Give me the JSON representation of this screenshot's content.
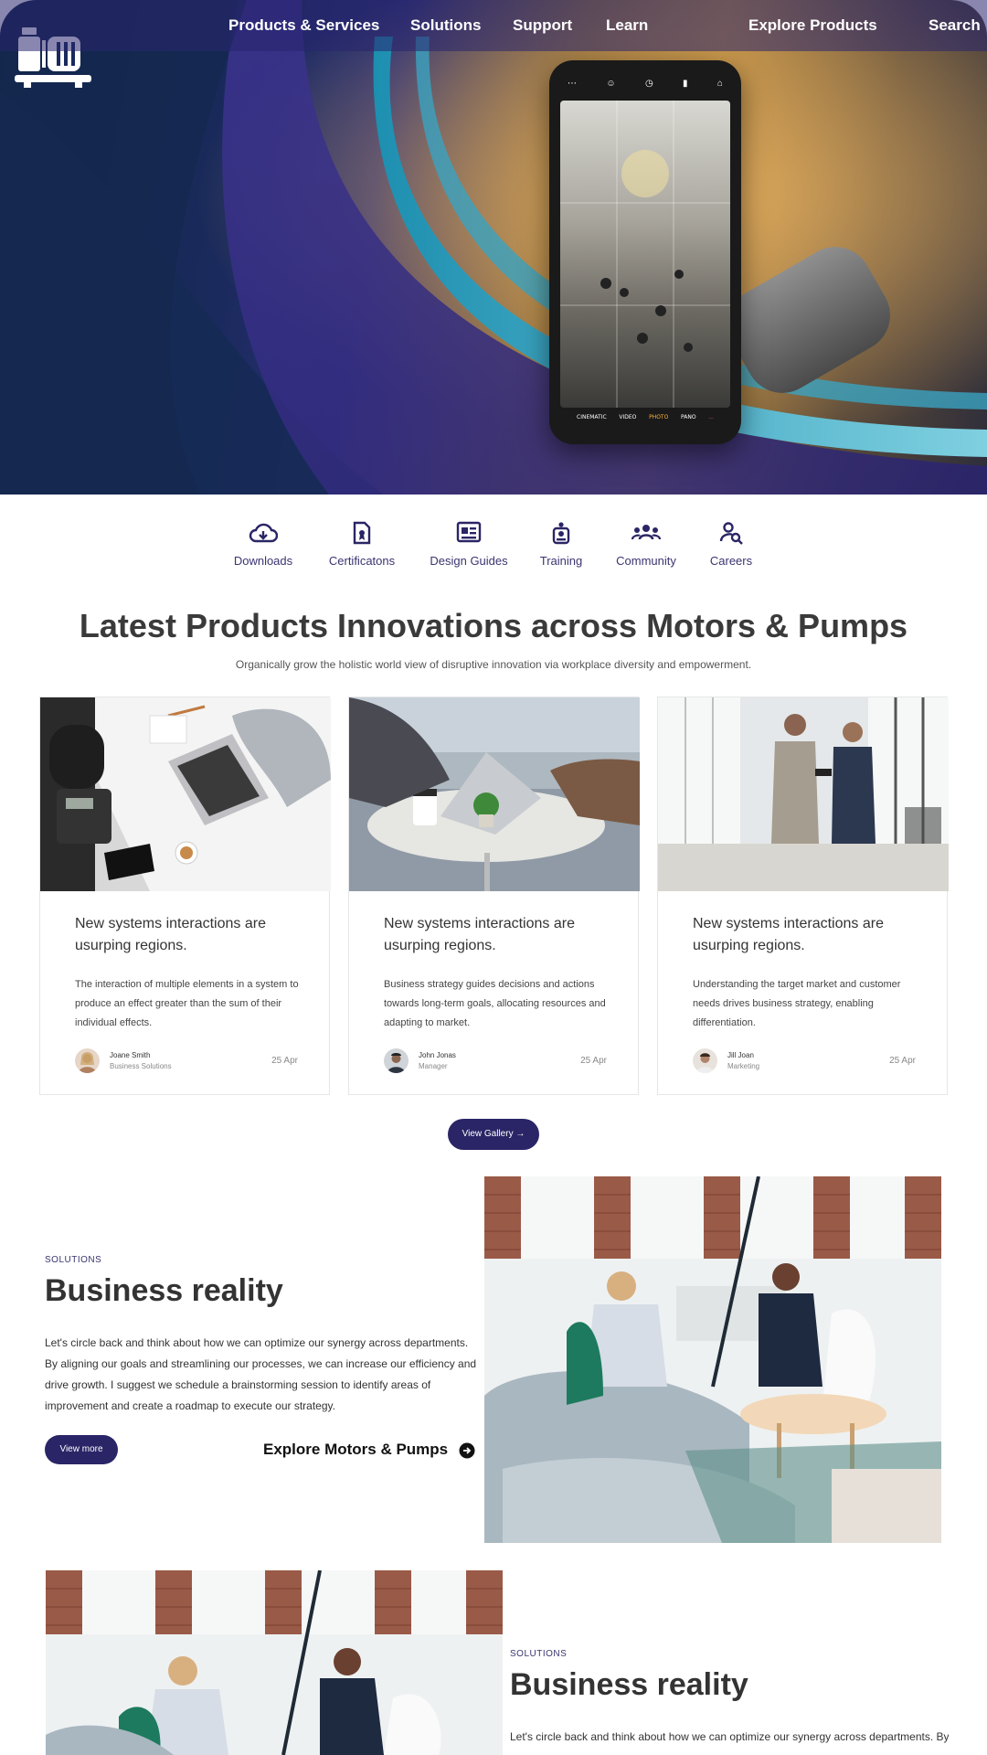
{
  "nav": {
    "items": [
      "Products & Services",
      "Solutions",
      "Support",
      "Learn"
    ],
    "explore": "Explore Products",
    "search": "Search"
  },
  "hero": {
    "phone_modes": [
      "CINEMATIC",
      "VIDEO",
      "PHOTO",
      "PANO",
      "..."
    ]
  },
  "quick_links": [
    {
      "label": "Downloads",
      "icon": "cloud-download-icon"
    },
    {
      "label": "Certificatons",
      "icon": "certificate-icon"
    },
    {
      "label": "Design Guides",
      "icon": "design-guide-icon"
    },
    {
      "label": "Training",
      "icon": "training-icon"
    },
    {
      "label": "Community",
      "icon": "community-icon"
    },
    {
      "label": "Careers",
      "icon": "careers-search-icon"
    }
  ],
  "latest": {
    "title": "Latest Products Innovations across Motors & Pumps",
    "subtitle": "Organically grow the holistic world view of disruptive innovation via workplace diversity and empowerment."
  },
  "cards": [
    {
      "title": "New systems interactions are usurping regions.",
      "body": "The interaction of multiple elements in a system to produce an effect greater than the sum of their individual effects.",
      "author": "Joane Smith",
      "role": "Business Solutions",
      "date": "25 Apr"
    },
    {
      "title": "New systems interactions are usurping regions.",
      "body": "Business strategy guides decisions and actions towards long-term goals, allocating resources and adapting to market.",
      "author": "John Jonas",
      "role": "Manager",
      "date": "25 Apr"
    },
    {
      "title": "New systems interactions are usurping regions.",
      "body": "Understanding the target market and customer needs drives business strategy, enabling differentiation.",
      "author": "Jill Joan",
      "role": "Marketing",
      "date": "25 Apr"
    }
  ],
  "gallery_button": "View Gallery →",
  "business": {
    "tag": "SOLUTIONS",
    "title": "Business reality",
    "text": "Let's circle back and think about how we can optimize our synergy across departments. By aligning our goals and streamlining our processes, we can increase our efficiency and drive growth. I suggest we schedule a brainstorming session to identify areas of improvement and create a roadmap to execute our strategy.",
    "view_more": "View more",
    "explore": "Explore Motors & Pumps"
  },
  "business2": {
    "tag": "SOLUTIONS",
    "title": "Business reality",
    "text": "Let's circle back and think about how we can optimize our synergy across departments. By"
  }
}
